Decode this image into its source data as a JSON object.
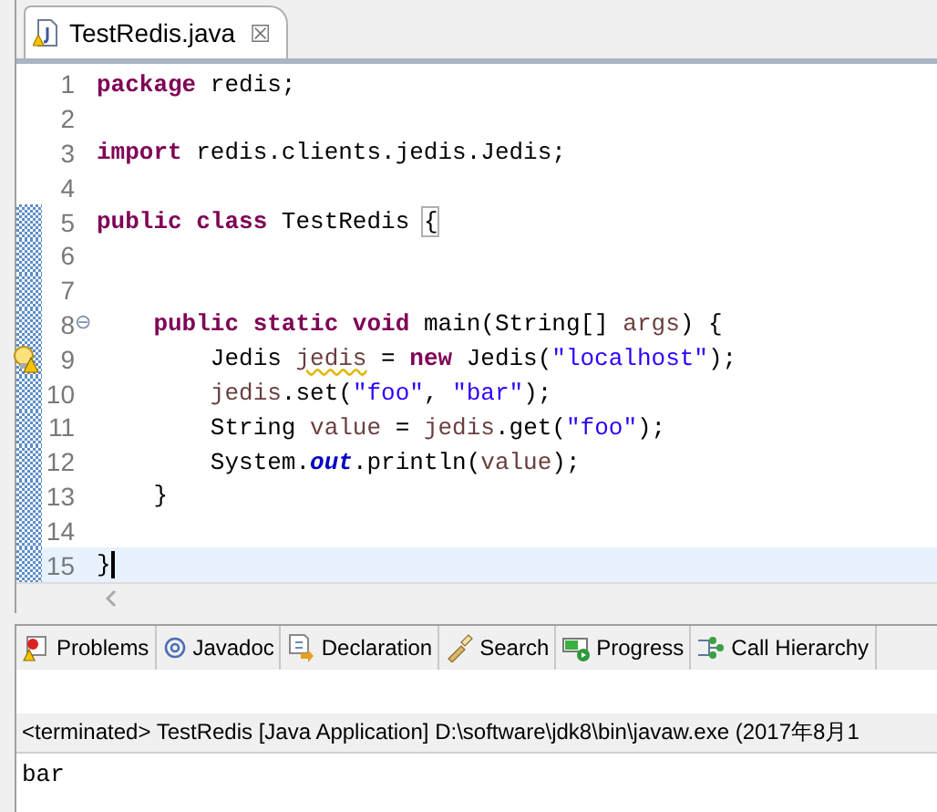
{
  "editor": {
    "tab": {
      "title": "TestRedis.java",
      "close": "☒"
    },
    "lines": [
      {
        "number": "1",
        "changed": false,
        "tokens": [
          {
            "kind": "kw",
            "text": "package"
          },
          {
            "kind": "plain",
            "text": " redis;"
          }
        ]
      },
      {
        "number": "2",
        "changed": false
      },
      {
        "number": "3",
        "changed": false,
        "tokens": [
          {
            "kind": "kw",
            "text": "import"
          },
          {
            "kind": "plain",
            "text": " redis.clients.jedis.Jedis;"
          }
        ]
      },
      {
        "number": "4",
        "changed": false
      },
      {
        "number": "5",
        "changed": true,
        "tokens": [
          {
            "kind": "kw",
            "text": "public"
          },
          {
            "kind": "kw",
            "text": " class"
          },
          {
            "kind": "plain",
            "text": " TestRedis "
          },
          {
            "kind": "match",
            "text": "{"
          }
        ]
      },
      {
        "number": "6",
        "changed": true
      },
      {
        "number": "7",
        "changed": true
      },
      {
        "number": "8",
        "changed": true,
        "fold": "⊖",
        "tokens": [
          {
            "kind": "kw",
            "text": "    public static void"
          },
          {
            "kind": "plain",
            "text": " main(String[] "
          },
          {
            "kind": "var",
            "text": "args"
          },
          {
            "kind": "plain",
            "text": ") {"
          }
        ]
      },
      {
        "number": "9",
        "changed": true,
        "warning": true,
        "tokens": [
          {
            "kind": "plain",
            "text": "        Jedis "
          },
          {
            "kind": "warn",
            "text": "jedis"
          },
          {
            "kind": "plain",
            "text": " = "
          },
          {
            "kind": "kw",
            "text": "new"
          },
          {
            "kind": "plain",
            "text": " Jedis("
          },
          {
            "kind": "str",
            "text": "\"localhost\""
          },
          {
            "kind": "plain",
            "text": ");"
          }
        ]
      },
      {
        "number": "10",
        "changed": true,
        "tokens": [
          {
            "kind": "var",
            "text": "        jedis"
          },
          {
            "kind": "plain",
            "text": ".set("
          },
          {
            "kind": "str",
            "text": "\"foo\""
          },
          {
            "kind": "plain",
            "text": ", "
          },
          {
            "kind": "str",
            "text": "\"bar\""
          },
          {
            "kind": "plain",
            "text": ");"
          }
        ]
      },
      {
        "number": "11",
        "changed": true,
        "tokens": [
          {
            "kind": "plain",
            "text": "        String "
          },
          {
            "kind": "var",
            "text": "value"
          },
          {
            "kind": "plain",
            "text": " = "
          },
          {
            "kind": "var",
            "text": "jedis"
          },
          {
            "kind": "plain",
            "text": ".get("
          },
          {
            "kind": "str",
            "text": "\"foo\""
          },
          {
            "kind": "plain",
            "text": ");"
          }
        ]
      },
      {
        "number": "12",
        "changed": true,
        "tokens": [
          {
            "kind": "plain",
            "text": "        System."
          },
          {
            "kind": "field",
            "text": "out"
          },
          {
            "kind": "plain",
            "text": ".println("
          },
          {
            "kind": "var",
            "text": "value"
          },
          {
            "kind": "plain",
            "text": ");"
          }
        ]
      },
      {
        "number": "13",
        "changed": true,
        "tokens": [
          {
            "kind": "plain",
            "text": "    }"
          }
        ]
      },
      {
        "number": "14",
        "changed": true
      },
      {
        "number": "15",
        "changed": true,
        "current": true,
        "tokens": [
          {
            "kind": "plain",
            "text": "}"
          }
        ]
      }
    ]
  },
  "panel": {
    "tabs": [
      {
        "label": "Problems",
        "kind": "problems"
      },
      {
        "label": "Javadoc",
        "kind": "javadoc"
      },
      {
        "label": "Declaration",
        "kind": "declaration"
      },
      {
        "label": "Search",
        "kind": "search"
      },
      {
        "label": "Progress",
        "kind": "progress"
      },
      {
        "label": "Call Hierarchy",
        "kind": "hierarchy"
      }
    ],
    "console": {
      "header": "<terminated> TestRedis [Java Application] D:\\software\\jdk8\\bin\\javaw.exe (2017年8月1",
      "output": "bar"
    }
  }
}
